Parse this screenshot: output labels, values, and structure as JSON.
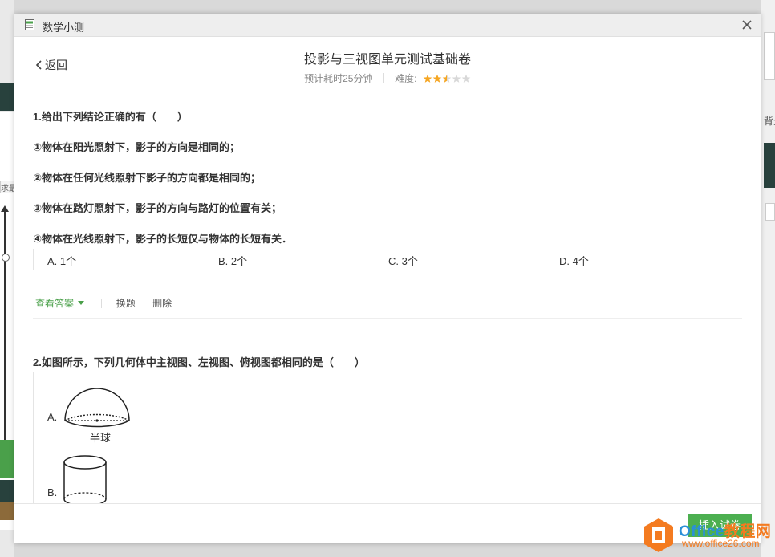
{
  "background": {
    "left_tag": "求最",
    "right_label": "背景"
  },
  "window": {
    "app_title": "数学小测",
    "close_icon": "close-icon"
  },
  "header": {
    "back_label": "返回",
    "paper_title": "投影与三视图单元测试基础卷",
    "time_text": "预计耗时25分钟",
    "difficulty_label": "难度:",
    "difficulty_rating": 2.5,
    "difficulty_max": 5
  },
  "questions": [
    {
      "stem": "1.给出下列结论正确的有（　　）",
      "statements": [
        "①物体在阳光照射下，影子的方向是相同的；",
        "②物体在任何光线照射下影子的方向都是相同的；",
        "③物体在路灯照射下，影子的方向与路灯的位置有关；",
        "④物体在光线照射下，影子的长短仅与物体的长短有关．"
      ],
      "options": [
        "A. 1个",
        "B. 2个",
        "C. 3个",
        "D. 4个"
      ],
      "actions": {
        "view_answer": "查看答案",
        "replace": "换题",
        "delete": "删除"
      }
    },
    {
      "stem": "2.如图所示，下列几何体中主视图、左视图、俯视图都相同的是（　　）",
      "options": [
        {
          "label": "A.",
          "caption": "半球",
          "figure": "hemisphere"
        },
        {
          "label": "B.",
          "caption": "",
          "figure": "cylinder"
        }
      ]
    }
  ],
  "footer": {
    "insert_label": "插入试卷"
  },
  "watermark": {
    "brand_latin": "Office",
    "brand_cn": "教程网",
    "url": "www.office26.com",
    "logo_color": "#f47b20"
  },
  "colors": {
    "accent_green": "#4caf50",
    "star_filled": "#f5a623",
    "star_empty": "#d8d8d8"
  }
}
